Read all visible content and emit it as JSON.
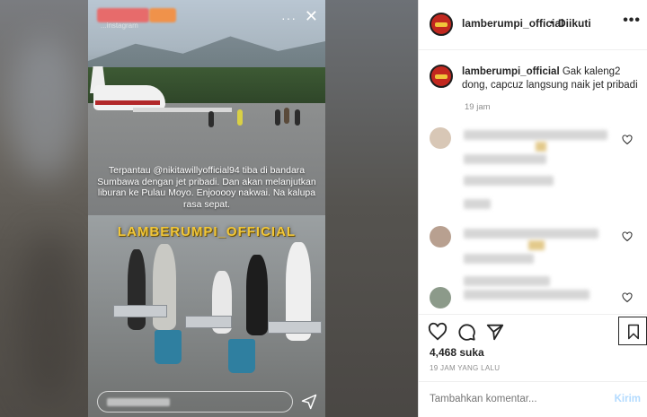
{
  "story": {
    "account_sub": "...instagram",
    "overlay_text": "Terpantau @nikitawillyofficial94 tiba di bandara Sumbawa dengan jet pribadi. Dan akan melanjutkan liburan ke Pulau Moyo. Enjooooy nakwai. Na kalupa rasa sepat.",
    "watermark": "LAMBERUMPI_OFFICIAL",
    "more_icon": "more-horizontal-icon",
    "close_icon": "close-icon",
    "send_icon": "send-icon"
  },
  "post": {
    "username": "lamberumpi_official",
    "separator": "•",
    "follow_status": "Diikuti",
    "more_label": "•••",
    "caption_user": "lamberumpi_official",
    "caption_text": " Gak kaleng2 dong, capcuz langsung naik jet pribadi",
    "caption_time": "19 jam",
    "likes": "4,468 suka",
    "time_ago": "19 JAM YANG LALU",
    "comment_placeholder": "Tambahkan komentar...",
    "post_button": "Kirim"
  },
  "colors": {
    "brand_avatar": "#c2281f",
    "watermark": "#f0c63a",
    "post_button_disabled": "#b3dbff"
  }
}
